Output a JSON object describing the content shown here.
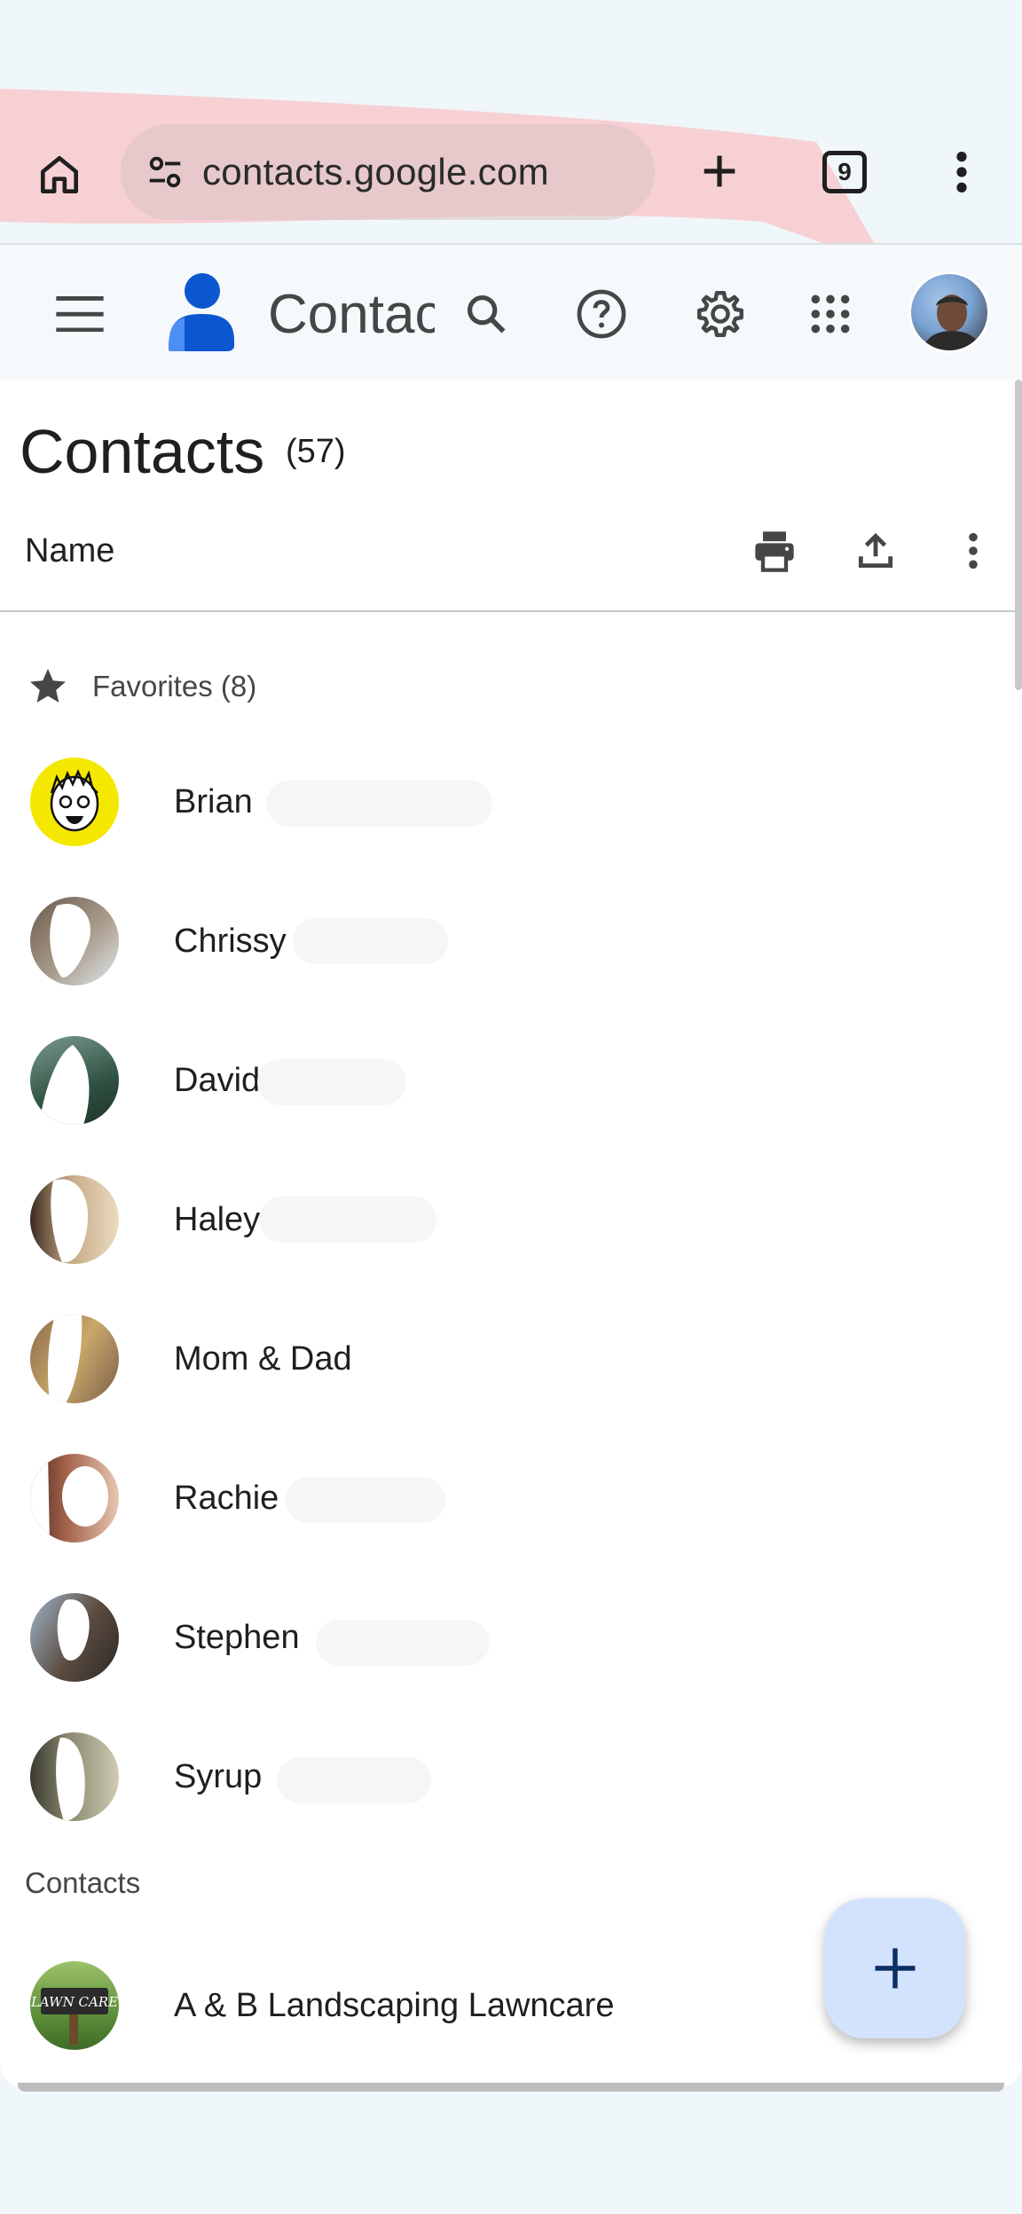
{
  "browser": {
    "url": "contacts.google.com",
    "tab_count": "9"
  },
  "header": {
    "app_name": "Contacts"
  },
  "page": {
    "title": "Contacts",
    "count": "(57)",
    "sort_label": "Name"
  },
  "favorites": {
    "label": "Favorites (8)",
    "items": [
      {
        "name": "Brian"
      },
      {
        "name": "Chrissy"
      },
      {
        "name": "David"
      },
      {
        "name": "Haley"
      },
      {
        "name": "Mom & Dad"
      },
      {
        "name": "Rachie"
      },
      {
        "name": "Stephen"
      },
      {
        "name": "Syrup"
      }
    ]
  },
  "contacts": {
    "label": "Contacts",
    "items": [
      {
        "name": "A & B Landscaping Lawncare",
        "avatar_text": "LAWN CARE"
      }
    ]
  },
  "colors": {
    "accent": "#0b57d0",
    "fab_bg": "#d3e3fd",
    "brian_avatar": "#f5e800"
  }
}
